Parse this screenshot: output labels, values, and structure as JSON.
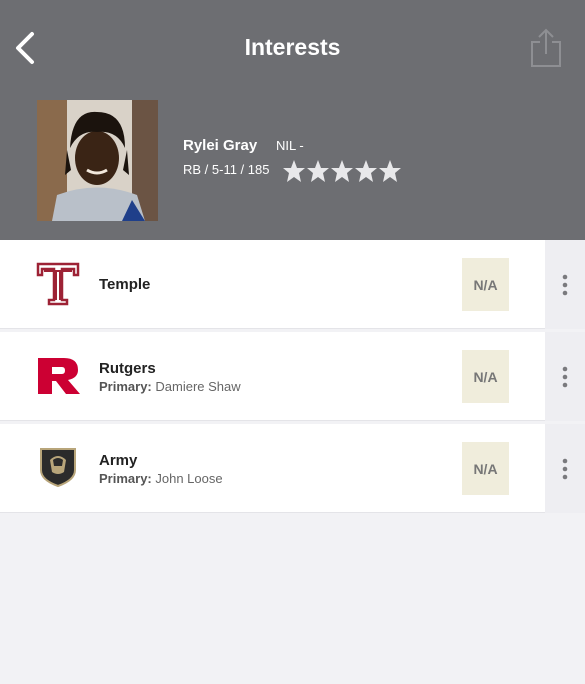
{
  "header": {
    "title": "Interests",
    "back_icon": "chevron-left-icon",
    "share_icon": "share-icon",
    "bg_color": "#6d6e72"
  },
  "player": {
    "name": "Rylei Gray",
    "nil": "NIL -",
    "position_size": "RB / 5-11 / 185",
    "stars": 5,
    "star_icon": "star-icon"
  },
  "schools": [
    {
      "name": "Temple",
      "coach_label": "",
      "coach": "",
      "status": "N/A",
      "logo": "temple-logo"
    },
    {
      "name": "Rutgers",
      "coach_label": "Primary:",
      "coach": "Damiere Shaw",
      "status": "N/A",
      "logo": "rutgers-logo"
    },
    {
      "name": "Army",
      "coach_label": "Primary:",
      "coach": "John Loose",
      "status": "N/A",
      "logo": "army-logo"
    }
  ],
  "colors": {
    "temple": "#9d2235",
    "rutgers": "#cc0033",
    "army": "#2b2b2b",
    "status_bg": "#f0eddc"
  }
}
